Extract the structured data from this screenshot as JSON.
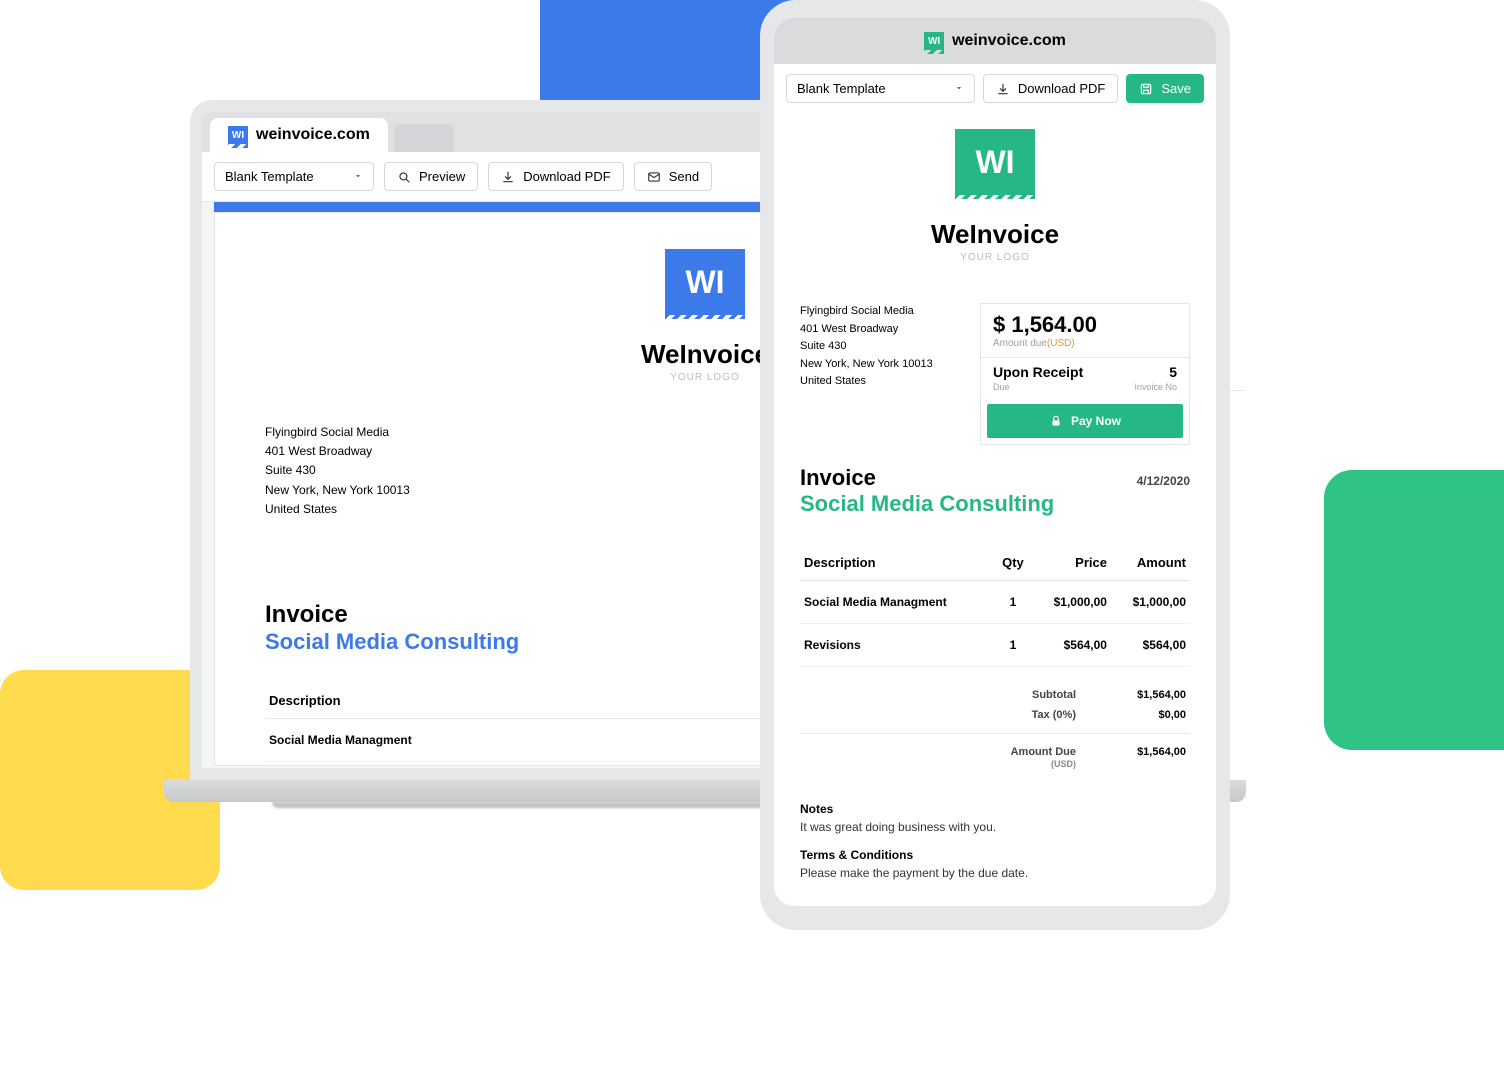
{
  "site": "weinvoice.com",
  "brand": {
    "name": "WeInvoice",
    "sub": "YOUR LOGO",
    "mark": "WI"
  },
  "template_label": "Blank Template",
  "buttons": {
    "preview": "Preview",
    "download": "Download PDF",
    "send": "Send",
    "save": "Save",
    "pay": "Pay Now",
    "pay_short": "Pay"
  },
  "address": {
    "l1": "Flyingbird Social Media",
    "l2": "401 West Broadway",
    "l3": "Suite 430",
    "l4": "New York, New York 10013",
    "l5": "United States"
  },
  "amount": {
    "display": "$ 1,564.00",
    "label": "Amount due",
    "currency": "(USD)",
    "due_term": "Upon Receipt",
    "due_label": "Due",
    "invno": "5",
    "invno_label": "Invoice No"
  },
  "invoice": {
    "title": "Invoice",
    "subject": "Social Media Consulting",
    "date": "4/12/2020"
  },
  "cols": {
    "desc": "Description",
    "qty": "Qty",
    "price": "Price",
    "amount": "Amount"
  },
  "items": [
    {
      "desc": "Social Media Managment",
      "qty": "1",
      "price": "$1,000,00",
      "amount": "$1,000,00"
    },
    {
      "desc": "Revisions",
      "qty": "1",
      "price": "$564,00",
      "amount": "$564,00"
    }
  ],
  "totals": {
    "subtotal_l": "Subtotal",
    "subtotal_v": "$1,564,00",
    "tax_l": "Tax (0%)",
    "tax_v": "$0,00",
    "due_l": "Amount Due",
    "due_sub": "(USD)",
    "due_v": "$1,564,00"
  },
  "notes": {
    "h": "Notes",
    "t": "It was great doing business with you."
  },
  "terms": {
    "h": "Terms & Conditions",
    "t": "Please make the payment by the due date."
  }
}
